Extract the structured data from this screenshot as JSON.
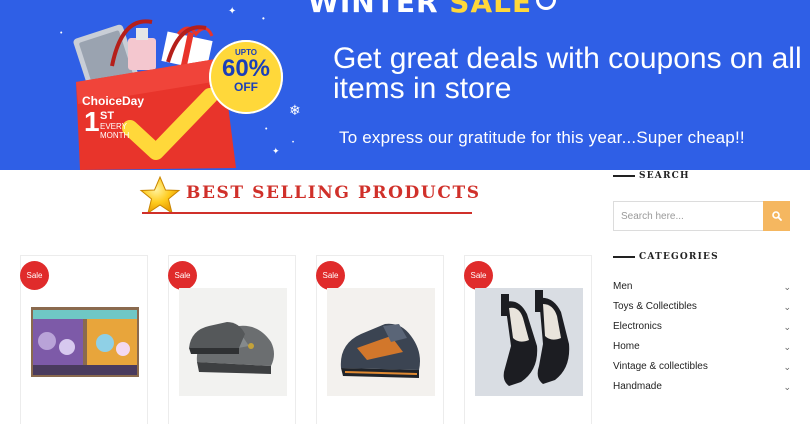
{
  "banner": {
    "title_main": "WINTER",
    "title_accent": "SALE",
    "headline": "Get great deals with coupons on all items in store",
    "subline": "To express our gratitude for this year...Super cheap!!",
    "bag_brand": "ChoiceDay",
    "bag_number": "1",
    "bag_suffix": "ST",
    "bag_every": "EVERY",
    "bag_month": "MONTH",
    "discount_upto": "UPTO",
    "discount_value": "60%",
    "discount_off": "OFF",
    "colors": {
      "background": "#2f5fe6",
      "accent": "#ffd83a",
      "bag": "#e8342b"
    }
  },
  "section": {
    "title": "BEST SELLING PRODUCTS",
    "accent_color": "#d0302a",
    "icon": "star-icon"
  },
  "products": [
    {
      "sale_label": "Sale",
      "image": "toy-set"
    },
    {
      "sale_label": "Sale",
      "image": "gray-work-shoe"
    },
    {
      "sale_label": "Sale",
      "image": "hiking-shoe"
    },
    {
      "sale_label": "Sale",
      "image": "two-tone-heels"
    }
  ],
  "sidebar": {
    "search_title": "SEARCH",
    "search_placeholder": "Search here...",
    "search_icon": "search-icon",
    "categories_title": "CATEGORIES",
    "categories": [
      {
        "label": "Men"
      },
      {
        "label": "Toys & Collectibles"
      },
      {
        "label": "Electronics"
      },
      {
        "label": "Home"
      },
      {
        "label": "Vintage & collectibles"
      },
      {
        "label": "Handmade"
      }
    ],
    "chevron_icon": "chevron-down-icon"
  }
}
